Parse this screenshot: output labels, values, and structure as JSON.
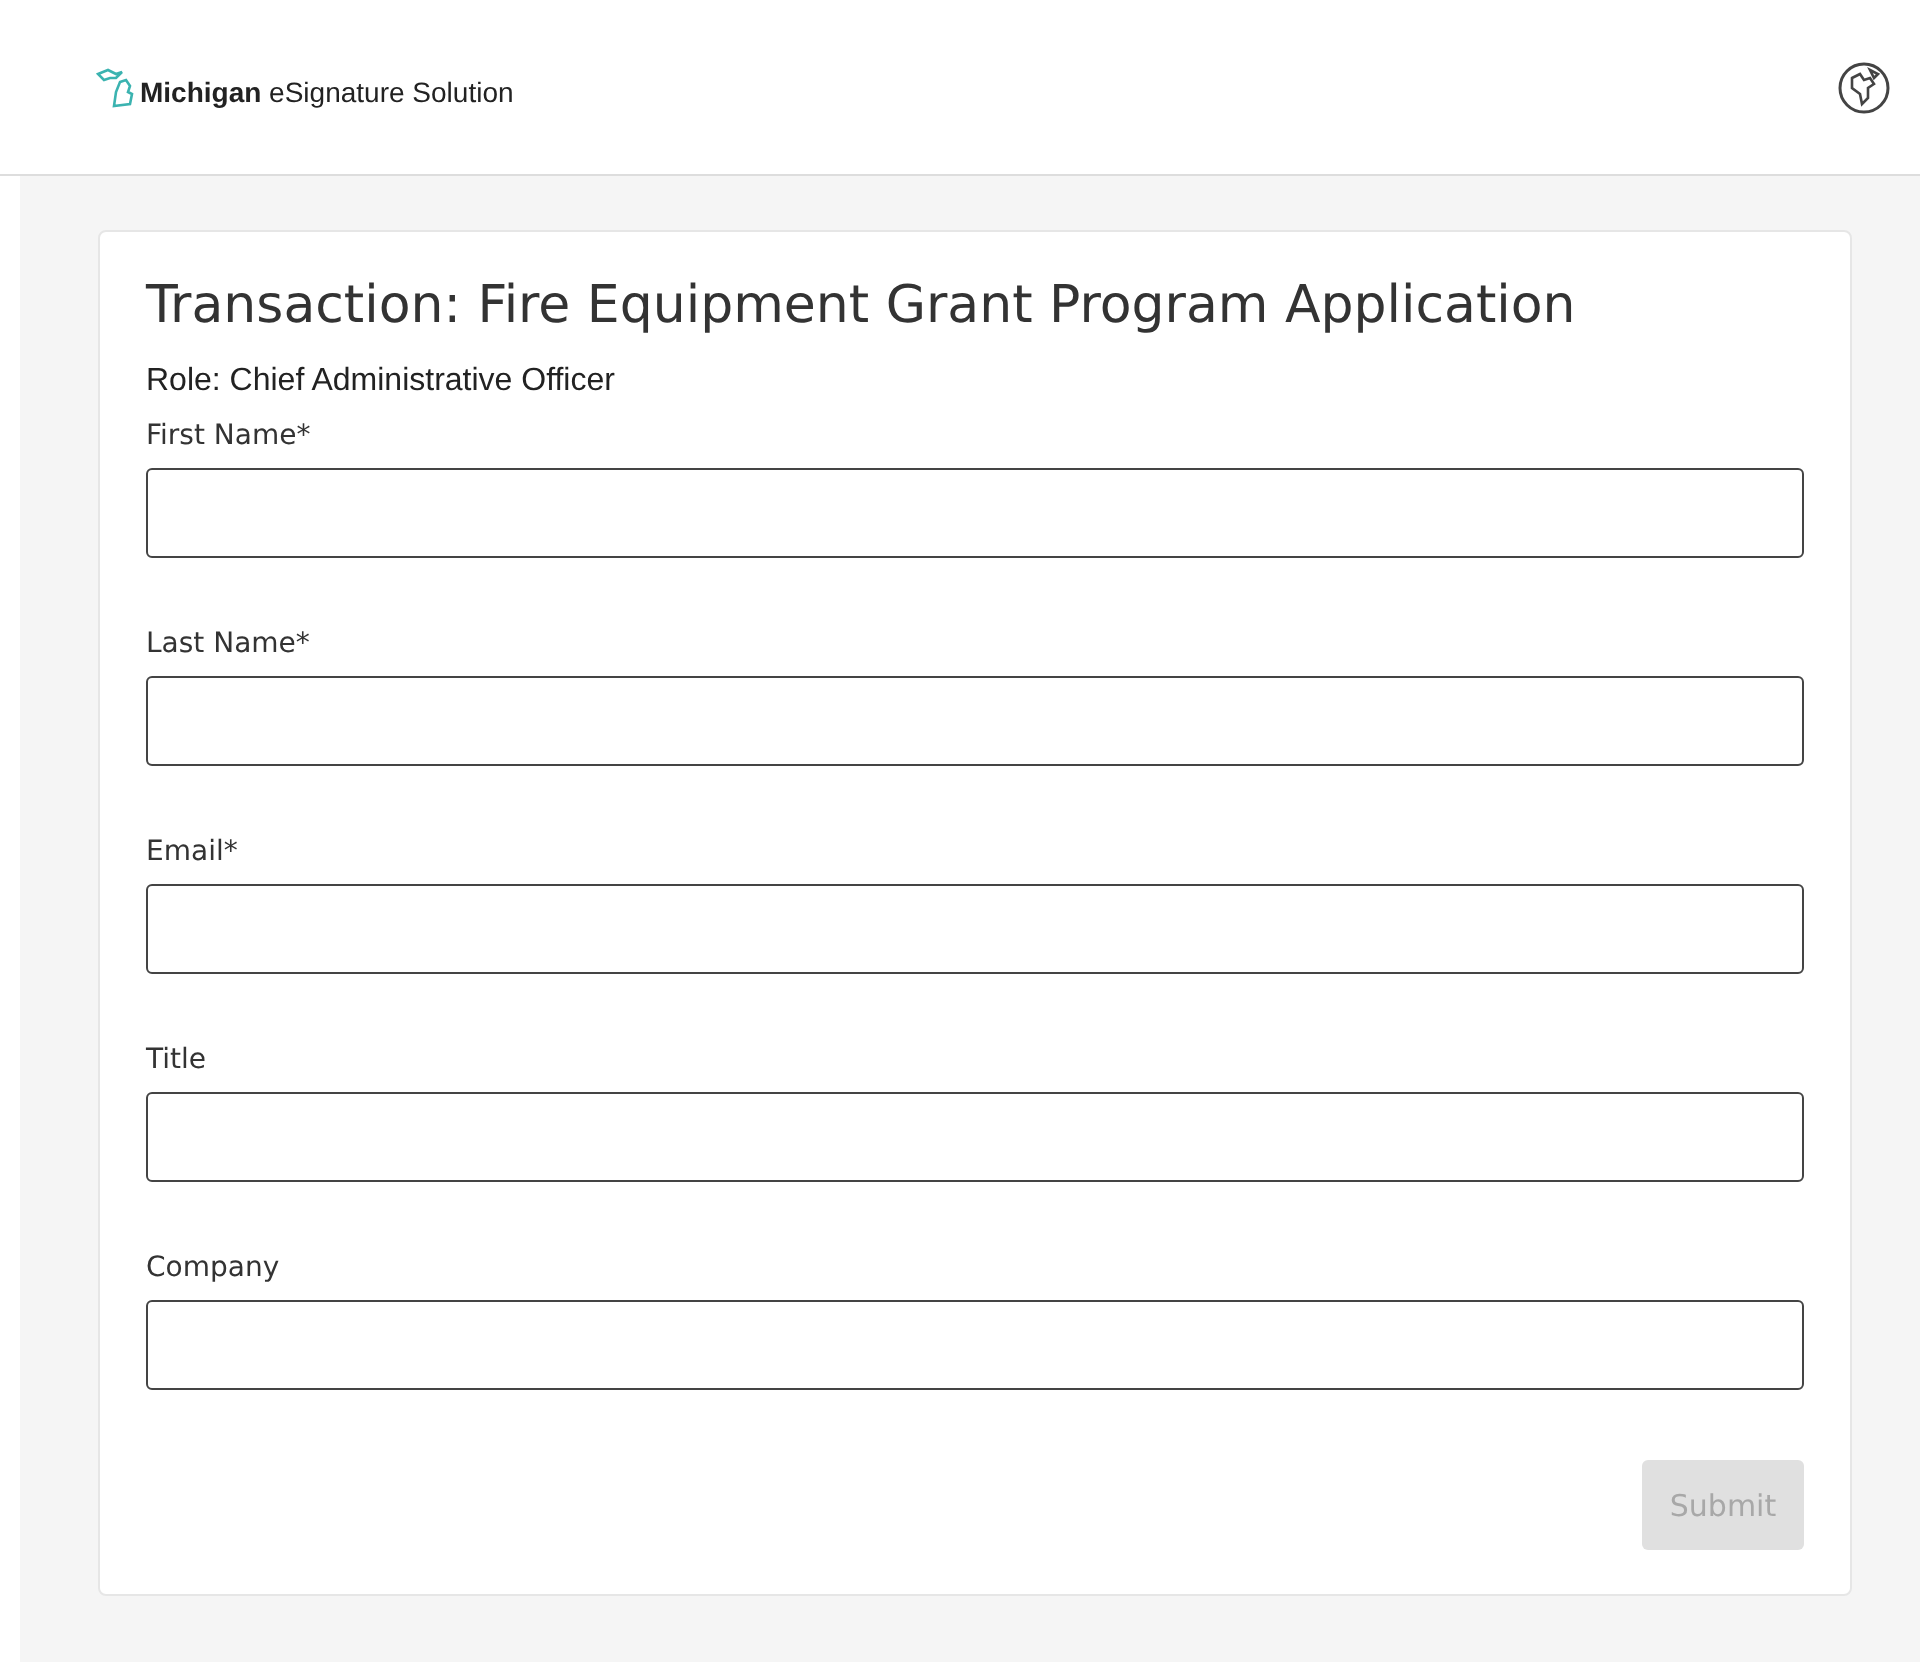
{
  "header": {
    "logo_text": "**Michigan** eSignature Solution"
  },
  "form": {
    "title": "Transaction: Fire Equipment Grant Program Application",
    "role": "Role: Chief Administrative Officer",
    "fields": [
      {
        "label": "First Name*"
      },
      {
        "label": "Last Name*"
      },
      {
        "label": "Email*"
      },
      {
        "label": "Title"
      },
      {
        "label": "Company"
      }
    ],
    "submit": {
      "label": "Submit",
      "disabled": true
    }
  }
}
